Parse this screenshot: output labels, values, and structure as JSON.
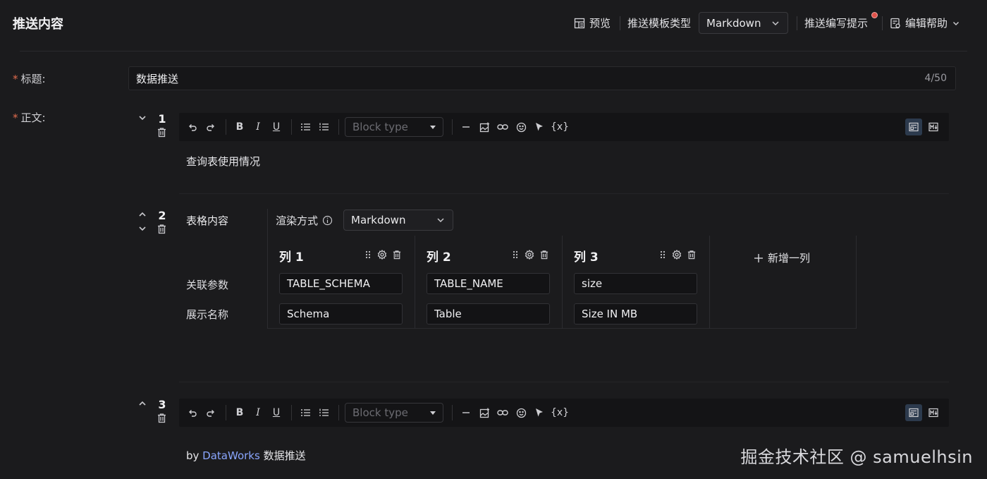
{
  "header": {
    "title": "推送内容",
    "preview_label": "预览",
    "template_type_label": "推送模板类型",
    "template_type_value": "Markdown",
    "writing_tips_label": "推送编写提示",
    "edit_help_label": "编辑帮助"
  },
  "form": {
    "title_label": "标题:",
    "title_value": "数据推送",
    "title_counter": "4/50",
    "body_label": "正文:"
  },
  "blocks": [
    {
      "number": "1",
      "block_type_placeholder": "Block type",
      "content": "查询表使用情况"
    },
    {
      "number": "2",
      "label": "表格内容",
      "render_label": "渲染方式",
      "render_value": "Markdown",
      "row_labels": [
        "关联参数",
        "展示名称"
      ],
      "columns": [
        {
          "header": "列 1",
          "param": "TABLE_SCHEMA",
          "display": "Schema"
        },
        {
          "header": "列 2",
          "param": "TABLE_NAME",
          "display": "Table"
        },
        {
          "header": "列 3",
          "param": "size",
          "display": "Size IN MB"
        }
      ],
      "add_column_label": "新增一列"
    },
    {
      "number": "3",
      "block_type_placeholder": "Block type",
      "content_prefix": "by ",
      "content_link": "DataWorks",
      "content_suffix": " 数据推送"
    }
  ],
  "toolbar": {
    "variable_label": "{x}",
    "bold": "B",
    "italic": "I",
    "underline": "U"
  },
  "watermark": "掘金技术社区 @ samuelhsin",
  "colors": {
    "background": "#1b1b1d",
    "link": "#8aa6ff",
    "required": "#e06b4d",
    "notify_dot": "#e0524a"
  }
}
